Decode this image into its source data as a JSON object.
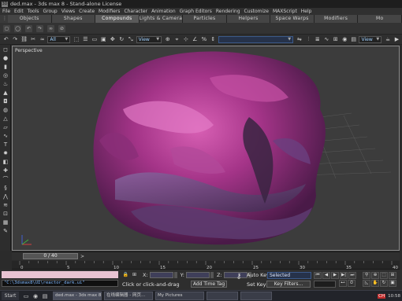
{
  "window": {
    "title": "ded.max - 3ds max 8 - Stand-alone License"
  },
  "menu": [
    "File",
    "Edit",
    "Tools",
    "Group",
    "Views",
    "Create",
    "Modifiers",
    "Character",
    "Animation",
    "Graph Editors",
    "Rendering",
    "Customize",
    "MAXScript",
    "Help"
  ],
  "tabs": [
    "Objects",
    "Shapes",
    "Compounds",
    "Lights & Cameras",
    "Particles",
    "Helpers",
    "Space Warps",
    "Modifiers",
    "Mo"
  ],
  "active_tab_index": 2,
  "toolbar": {
    "filter_select": "All",
    "view_select_1": "View",
    "view_select_2": "View"
  },
  "viewport": {
    "label": "Perspective"
  },
  "timeline": {
    "slider_text": "0 / 40",
    "next_glyph": ">",
    "ruler_ticks": [
      "0",
      "5",
      "10",
      "15",
      "20",
      "25",
      "30",
      "35",
      "40"
    ]
  },
  "status": {
    "script_path": "\"C:\\3dsmax8\\UI\\reactor_dark.ui\"",
    "coord_labels": [
      "X:",
      "Y:",
      "Z:"
    ],
    "prompt": "Click or click-and-drag",
    "add_time_tag": "Add Time Tag",
    "auto_key": "Auto Key",
    "set_key": "Set Key",
    "selected": "Selected",
    "key_filters": "Key Filters..."
  },
  "taskbar": {
    "start": "Start",
    "tasks": [
      "ded.max - 3ds max 8",
      "在线编辑器 - 网页...",
      "My Pictures",
      "",
      "",
      ""
    ],
    "tray": [
      "CH",
      "10:58"
    ]
  },
  "colors": {
    "accent": "#3c5a8a",
    "object": "#b43c8c",
    "viewport_bg": "#3c3c3c"
  }
}
